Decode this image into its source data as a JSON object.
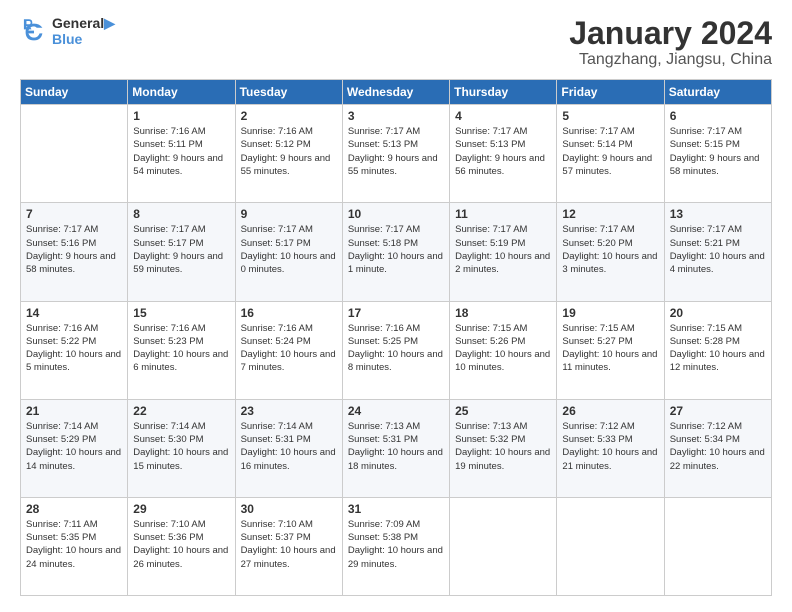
{
  "logo": {
    "line1": "General",
    "line2": "Blue"
  },
  "title": "January 2024",
  "subtitle": "Tangzhang, Jiangsu, China",
  "weekdays": [
    "Sunday",
    "Monday",
    "Tuesday",
    "Wednesday",
    "Thursday",
    "Friday",
    "Saturday"
  ],
  "weeks": [
    [
      {
        "day": "",
        "sunrise": "",
        "sunset": "",
        "daylight": ""
      },
      {
        "day": "1",
        "sunrise": "Sunrise: 7:16 AM",
        "sunset": "Sunset: 5:11 PM",
        "daylight": "Daylight: 9 hours and 54 minutes."
      },
      {
        "day": "2",
        "sunrise": "Sunrise: 7:16 AM",
        "sunset": "Sunset: 5:12 PM",
        "daylight": "Daylight: 9 hours and 55 minutes."
      },
      {
        "day": "3",
        "sunrise": "Sunrise: 7:17 AM",
        "sunset": "Sunset: 5:13 PM",
        "daylight": "Daylight: 9 hours and 55 minutes."
      },
      {
        "day": "4",
        "sunrise": "Sunrise: 7:17 AM",
        "sunset": "Sunset: 5:13 PM",
        "daylight": "Daylight: 9 hours and 56 minutes."
      },
      {
        "day": "5",
        "sunrise": "Sunrise: 7:17 AM",
        "sunset": "Sunset: 5:14 PM",
        "daylight": "Daylight: 9 hours and 57 minutes."
      },
      {
        "day": "6",
        "sunrise": "Sunrise: 7:17 AM",
        "sunset": "Sunset: 5:15 PM",
        "daylight": "Daylight: 9 hours and 58 minutes."
      }
    ],
    [
      {
        "day": "7",
        "sunrise": "Sunrise: 7:17 AM",
        "sunset": "Sunset: 5:16 PM",
        "daylight": "Daylight: 9 hours and 58 minutes."
      },
      {
        "day": "8",
        "sunrise": "Sunrise: 7:17 AM",
        "sunset": "Sunset: 5:17 PM",
        "daylight": "Daylight: 9 hours and 59 minutes."
      },
      {
        "day": "9",
        "sunrise": "Sunrise: 7:17 AM",
        "sunset": "Sunset: 5:17 PM",
        "daylight": "Daylight: 10 hours and 0 minutes."
      },
      {
        "day": "10",
        "sunrise": "Sunrise: 7:17 AM",
        "sunset": "Sunset: 5:18 PM",
        "daylight": "Daylight: 10 hours and 1 minute."
      },
      {
        "day": "11",
        "sunrise": "Sunrise: 7:17 AM",
        "sunset": "Sunset: 5:19 PM",
        "daylight": "Daylight: 10 hours and 2 minutes."
      },
      {
        "day": "12",
        "sunrise": "Sunrise: 7:17 AM",
        "sunset": "Sunset: 5:20 PM",
        "daylight": "Daylight: 10 hours and 3 minutes."
      },
      {
        "day": "13",
        "sunrise": "Sunrise: 7:17 AM",
        "sunset": "Sunset: 5:21 PM",
        "daylight": "Daylight: 10 hours and 4 minutes."
      }
    ],
    [
      {
        "day": "14",
        "sunrise": "Sunrise: 7:16 AM",
        "sunset": "Sunset: 5:22 PM",
        "daylight": "Daylight: 10 hours and 5 minutes."
      },
      {
        "day": "15",
        "sunrise": "Sunrise: 7:16 AM",
        "sunset": "Sunset: 5:23 PM",
        "daylight": "Daylight: 10 hours and 6 minutes."
      },
      {
        "day": "16",
        "sunrise": "Sunrise: 7:16 AM",
        "sunset": "Sunset: 5:24 PM",
        "daylight": "Daylight: 10 hours and 7 minutes."
      },
      {
        "day": "17",
        "sunrise": "Sunrise: 7:16 AM",
        "sunset": "Sunset: 5:25 PM",
        "daylight": "Daylight: 10 hours and 8 minutes."
      },
      {
        "day": "18",
        "sunrise": "Sunrise: 7:15 AM",
        "sunset": "Sunset: 5:26 PM",
        "daylight": "Daylight: 10 hours and 10 minutes."
      },
      {
        "day": "19",
        "sunrise": "Sunrise: 7:15 AM",
        "sunset": "Sunset: 5:27 PM",
        "daylight": "Daylight: 10 hours and 11 minutes."
      },
      {
        "day": "20",
        "sunrise": "Sunrise: 7:15 AM",
        "sunset": "Sunset: 5:28 PM",
        "daylight": "Daylight: 10 hours and 12 minutes."
      }
    ],
    [
      {
        "day": "21",
        "sunrise": "Sunrise: 7:14 AM",
        "sunset": "Sunset: 5:29 PM",
        "daylight": "Daylight: 10 hours and 14 minutes."
      },
      {
        "day": "22",
        "sunrise": "Sunrise: 7:14 AM",
        "sunset": "Sunset: 5:30 PM",
        "daylight": "Daylight: 10 hours and 15 minutes."
      },
      {
        "day": "23",
        "sunrise": "Sunrise: 7:14 AM",
        "sunset": "Sunset: 5:31 PM",
        "daylight": "Daylight: 10 hours and 16 minutes."
      },
      {
        "day": "24",
        "sunrise": "Sunrise: 7:13 AM",
        "sunset": "Sunset: 5:31 PM",
        "daylight": "Daylight: 10 hours and 18 minutes."
      },
      {
        "day": "25",
        "sunrise": "Sunrise: 7:13 AM",
        "sunset": "Sunset: 5:32 PM",
        "daylight": "Daylight: 10 hours and 19 minutes."
      },
      {
        "day": "26",
        "sunrise": "Sunrise: 7:12 AM",
        "sunset": "Sunset: 5:33 PM",
        "daylight": "Daylight: 10 hours and 21 minutes."
      },
      {
        "day": "27",
        "sunrise": "Sunrise: 7:12 AM",
        "sunset": "Sunset: 5:34 PM",
        "daylight": "Daylight: 10 hours and 22 minutes."
      }
    ],
    [
      {
        "day": "28",
        "sunrise": "Sunrise: 7:11 AM",
        "sunset": "Sunset: 5:35 PM",
        "daylight": "Daylight: 10 hours and 24 minutes."
      },
      {
        "day": "29",
        "sunrise": "Sunrise: 7:10 AM",
        "sunset": "Sunset: 5:36 PM",
        "daylight": "Daylight: 10 hours and 26 minutes."
      },
      {
        "day": "30",
        "sunrise": "Sunrise: 7:10 AM",
        "sunset": "Sunset: 5:37 PM",
        "daylight": "Daylight: 10 hours and 27 minutes."
      },
      {
        "day": "31",
        "sunrise": "Sunrise: 7:09 AM",
        "sunset": "Sunset: 5:38 PM",
        "daylight": "Daylight: 10 hours and 29 minutes."
      },
      {
        "day": "",
        "sunrise": "",
        "sunset": "",
        "daylight": ""
      },
      {
        "day": "",
        "sunrise": "",
        "sunset": "",
        "daylight": ""
      },
      {
        "day": "",
        "sunrise": "",
        "sunset": "",
        "daylight": ""
      }
    ]
  ]
}
